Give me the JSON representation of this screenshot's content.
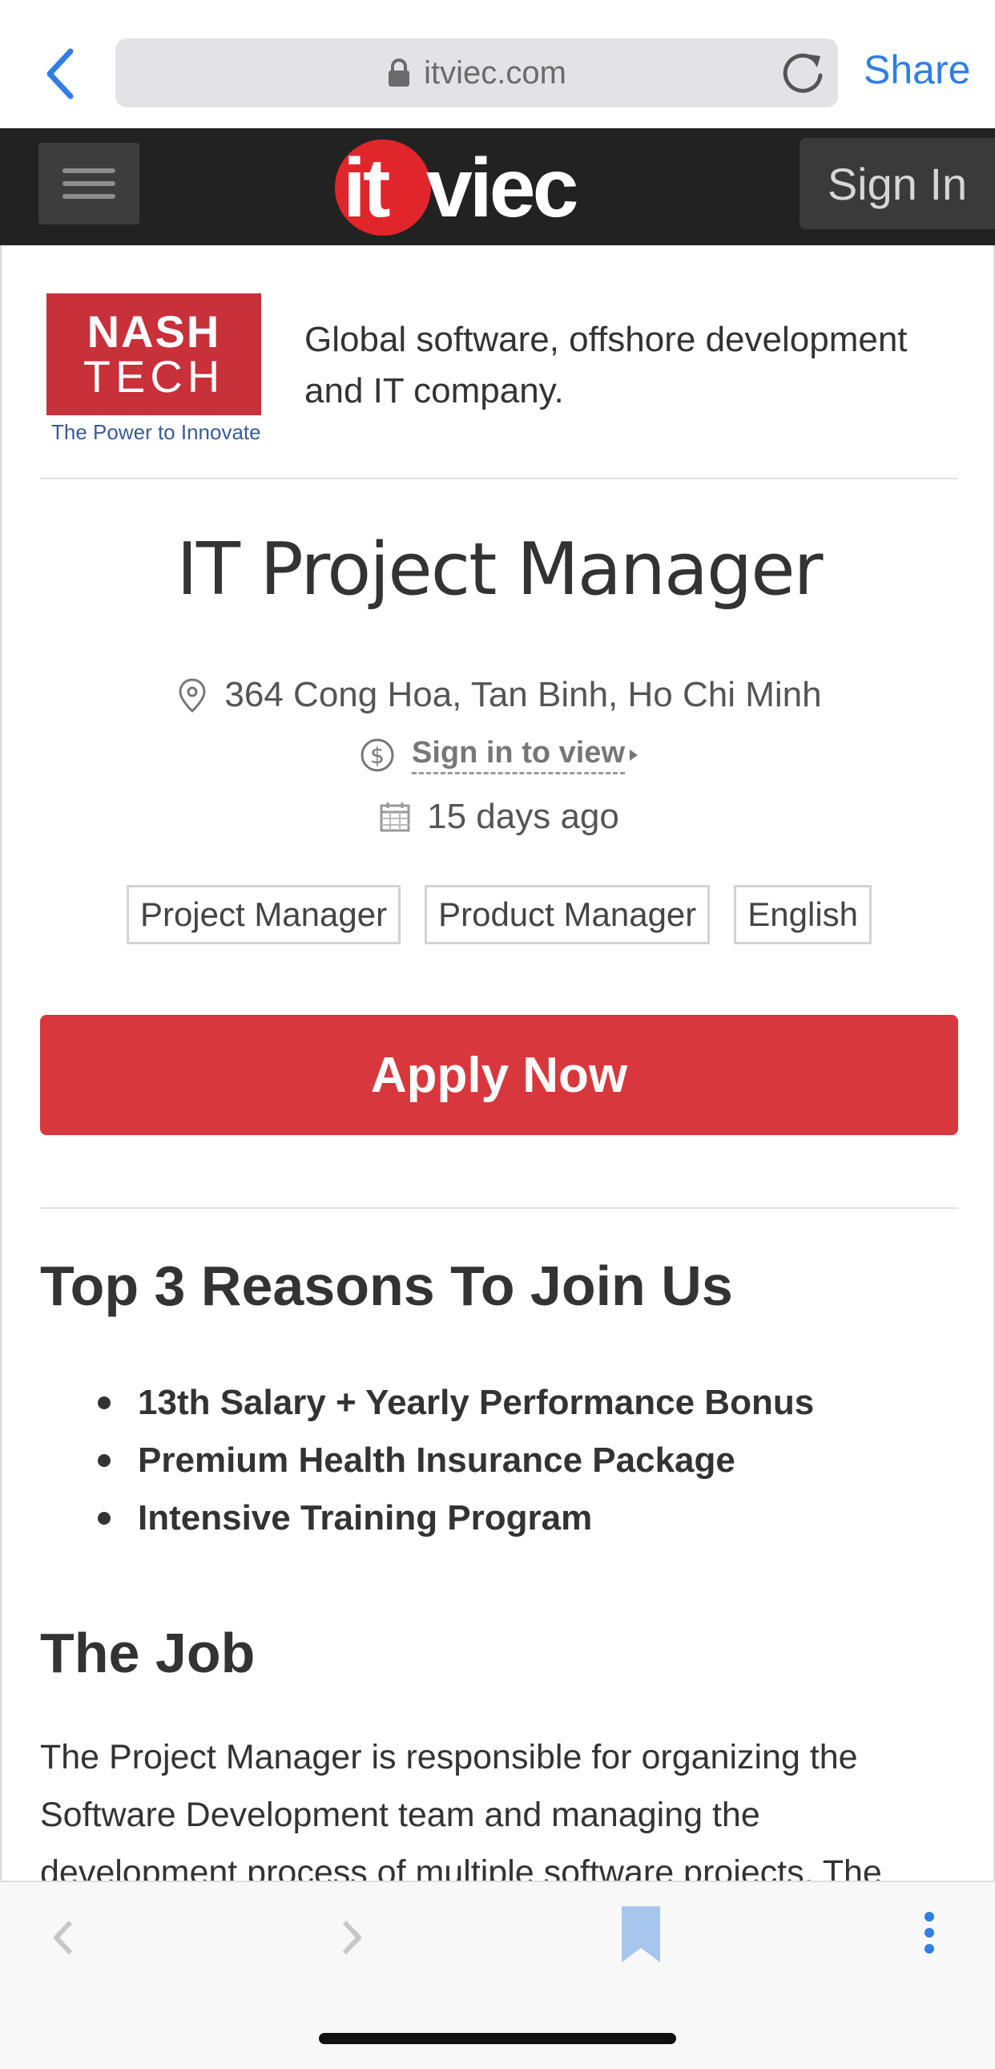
{
  "browser": {
    "url": "itviec.com",
    "share_label": "Share"
  },
  "site_header": {
    "logo_it": "it",
    "logo_viec": "viec",
    "signin_label": "Sign In"
  },
  "company": {
    "logo_line1": "NASH",
    "logo_line2": "TECH",
    "logo_tagline": "The Power to Innovate",
    "description": "Global software, offshore development and IT company."
  },
  "job": {
    "title": "IT Project Manager",
    "location": "364 Cong Hoa, Tan Binh, Ho Chi Minh",
    "salary_link": "Sign in to view",
    "posted": "15 days ago",
    "tags": [
      "Project Manager",
      "Product Manager",
      "English"
    ],
    "apply_label": "Apply Now"
  },
  "reasons": {
    "title": "Top 3 Reasons To Join Us",
    "items": [
      "13th Salary + Yearly Performance Bonus",
      "Premium Health Insurance Package",
      "Intensive Training Program"
    ]
  },
  "the_job": {
    "title": "The Job",
    "description": "The Project Manager is responsible for organizing the Software Development team and managing the development process of multiple software projects. The"
  },
  "colors": {
    "brand_red": "#d8373d",
    "header_dark": "#222222",
    "ios_blue": "#2f7ee4"
  },
  "icons": {
    "back": "chevron-left-icon",
    "lock": "lock-icon",
    "reload": "reload-icon",
    "menu": "hamburger-icon",
    "location": "map-pin-icon",
    "salary": "dollar-circle-icon",
    "calendar": "calendar-icon",
    "bookmark": "bookmark-icon",
    "more": "more-vertical-icon"
  }
}
